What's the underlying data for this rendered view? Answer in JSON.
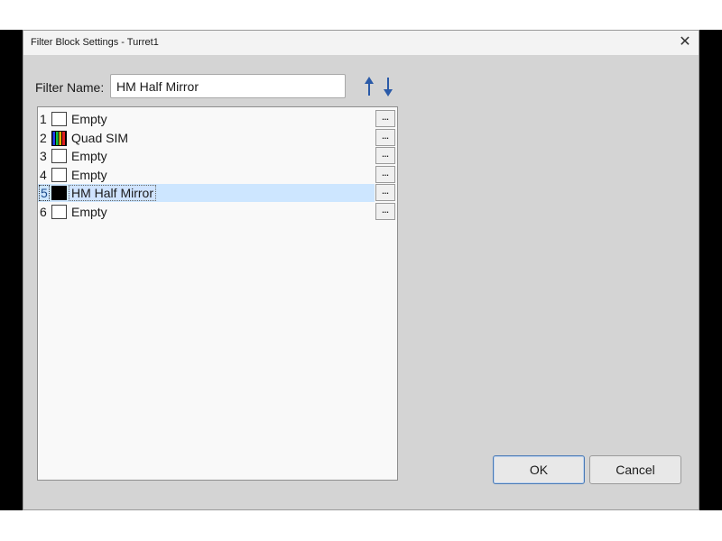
{
  "window": {
    "title": "Filter Block Settings - Turret1",
    "close_glyph": "✕"
  },
  "filter_name": {
    "label": "Filter Name:",
    "value": "HM Half Mirror"
  },
  "arrows": {
    "up_icon": "arrow-up-icon",
    "down_icon": "arrow-down-icon",
    "color": "#2a5aa8"
  },
  "filters": [
    {
      "num": "1",
      "label": "Empty",
      "swatch": "empty"
    },
    {
      "num": "2",
      "label": "Quad SIM",
      "swatch": "quad"
    },
    {
      "num": "3",
      "label": "Empty",
      "swatch": "empty"
    },
    {
      "num": "4",
      "label": "Empty",
      "swatch": "empty"
    },
    {
      "num": "5",
      "label": "HM Half Mirror",
      "swatch": "black",
      "selected": true
    },
    {
      "num": "6",
      "label": "Empty",
      "swatch": "empty"
    }
  ],
  "row_button_label": "...",
  "buttons": {
    "ok": "OK",
    "cancel": "Cancel"
  },
  "colors": {
    "selection": "#cde6ff",
    "dialog_bg": "#d4d4d4",
    "ok_border": "#4a7ab5"
  }
}
